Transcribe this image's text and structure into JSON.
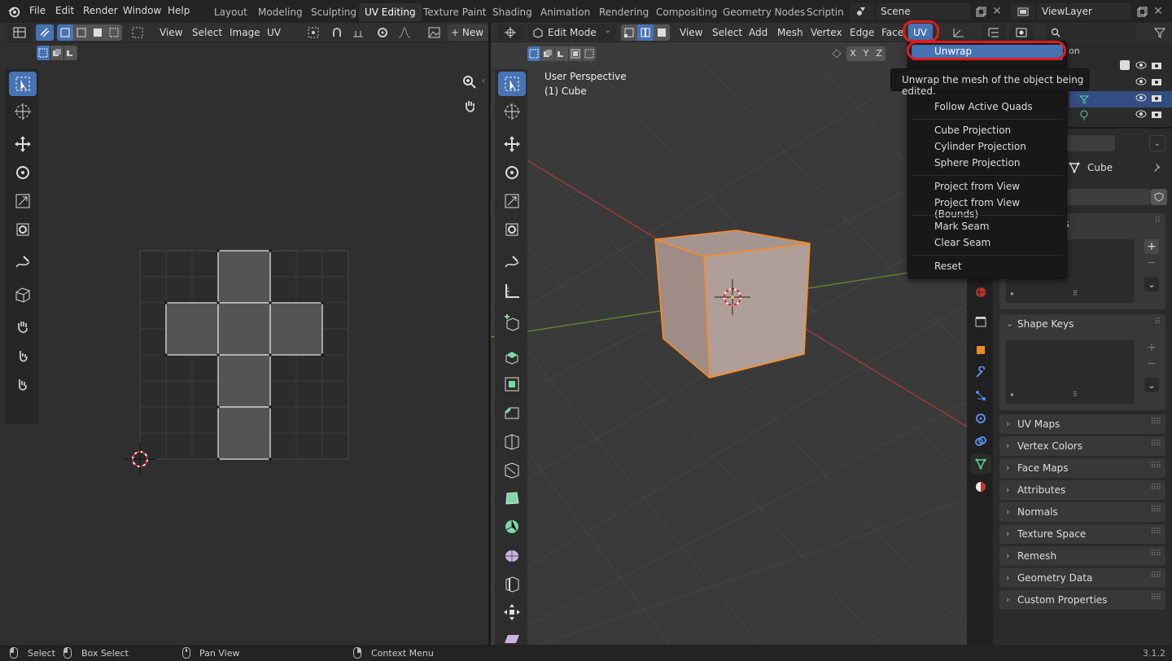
{
  "topbar": {
    "menus": [
      "File",
      "Edit",
      "Render",
      "Window",
      "Help"
    ],
    "workspaces": [
      "Layout",
      "Modeling",
      "Sculpting",
      "UV Editing",
      "Texture Paint",
      "Shading",
      "Animation",
      "Rendering",
      "Compositing",
      "Geometry Nodes",
      "Scripting"
    ],
    "active_workspace": "UV Editing",
    "scene_label": "Scene",
    "viewlayer_label": "ViewLayer"
  },
  "uv_editor": {
    "header_menus": [
      "View",
      "Select",
      "Image",
      "UV"
    ],
    "new_label": "New",
    "new_prefix": "+"
  },
  "view3d": {
    "mode_label": "Edit Mode",
    "header_menus": [
      "View",
      "Select",
      "Add",
      "Mesh",
      "Vertex",
      "Edge",
      "Face",
      "UV"
    ],
    "perspective_label": "User Perspective",
    "object_label": "(1) Cube",
    "axis_labels": [
      "X",
      "Y",
      "Z"
    ]
  },
  "uv_menu": {
    "title": "UV",
    "items": [
      "Unwrap",
      "Follow Active Quads",
      "Cube Projection",
      "Cylinder Projection",
      "Sphere Projection",
      "Project from View",
      "Project from View (Bounds)",
      "Mark Seam",
      "Clear Seam",
      "Reset"
    ],
    "highlighted": "Unwrap",
    "tooltip": "Unwrap the mesh of the object being edited."
  },
  "properties": {
    "outliner_partial_label": "on",
    "object_name": "Cube",
    "panels": [
      "Shape Keys",
      "UV Maps",
      "Vertex Colors",
      "Face Maps",
      "Attributes",
      "Normals",
      "Texture Space",
      "Remesh",
      "Geometry Data",
      "Custom Properties"
    ],
    "partial_panel_label": "ps"
  },
  "statusbar": {
    "select": "Select",
    "box_select": "Box Select",
    "pan_view": "Pan View",
    "context_menu": "Context Menu",
    "version": "3.1.2"
  },
  "colors": {
    "accent": "#4772b3",
    "highlight_ring": "#e21b1b",
    "selected_edge": "#ff8a1f"
  }
}
